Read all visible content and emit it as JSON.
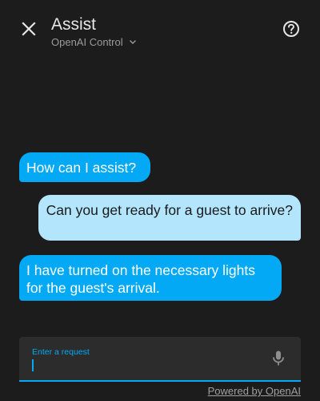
{
  "header": {
    "title": "Assist",
    "pipeline_label": "OpenAI Control",
    "close_icon": "close-icon",
    "help_icon": "help-circle-icon",
    "chevron_icon": "chevron-down-icon"
  },
  "conversation": {
    "messages": [
      {
        "sender": "agent",
        "text": "How can I assist?"
      },
      {
        "sender": "user",
        "text": "Can you get ready for a guest to arrive?"
      },
      {
        "sender": "agent",
        "text": "I have turned on the necessary lights for the guest's arrival."
      }
    ]
  },
  "input": {
    "label": "Enter a request",
    "value": "",
    "mic_icon": "microphone-icon"
  },
  "footer": {
    "powered_by": "Powered by OpenAI"
  },
  "colors": {
    "background": "#1c1c1c",
    "accent": "#03a9f4",
    "user_bubble": "#b3e5fc",
    "input_background": "#2c2c2c"
  }
}
